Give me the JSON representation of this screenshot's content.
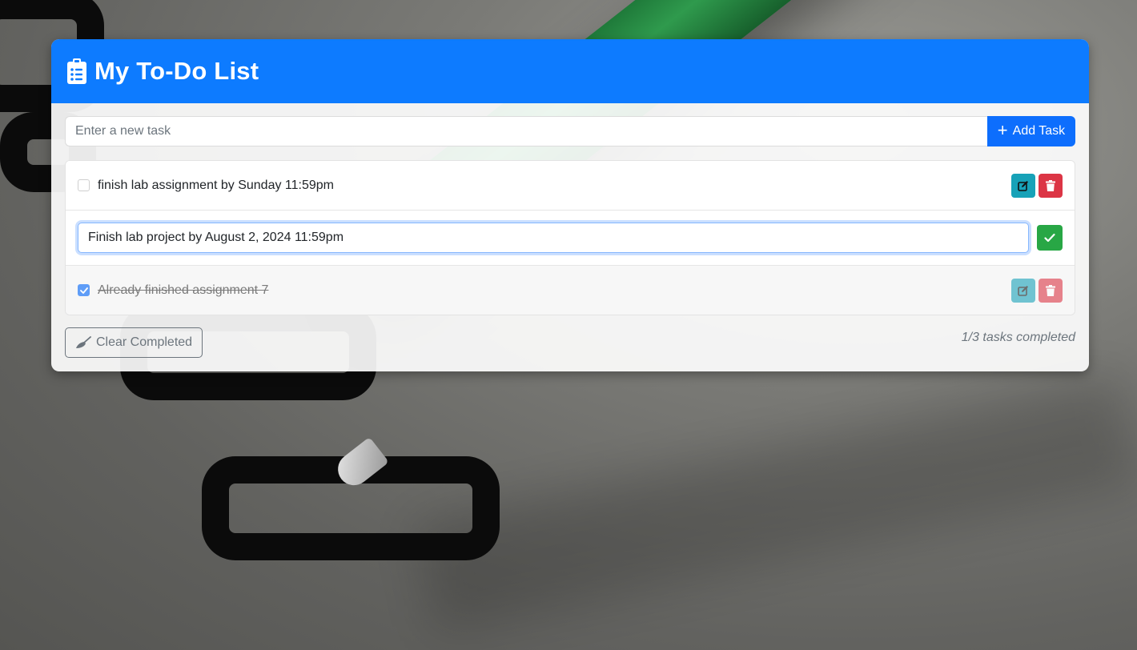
{
  "header": {
    "title": "My To-Do List"
  },
  "new_task": {
    "placeholder": "Enter a new task",
    "value": "",
    "add_label": "Add Task"
  },
  "tasks": [
    {
      "text": "finish lab assignment by Sunday 11:59pm",
      "completed": false,
      "mode": "view"
    },
    {
      "text": "Finish lab project by August 2, 2024 11:59pm",
      "completed": false,
      "mode": "editing"
    },
    {
      "text": "Already finished assignment 7",
      "completed": true,
      "mode": "view"
    }
  ],
  "footer": {
    "clear_label": "Clear Completed",
    "status": "1/3 tasks completed"
  },
  "colors": {
    "primary": "#0d6efd",
    "header": "#0d7bff",
    "info": "#17a2b8",
    "danger": "#dc3545",
    "success": "#28a745"
  },
  "icons": {
    "header": "clipboard-list-icon",
    "add": "plus-icon",
    "edit": "edit-icon",
    "delete": "trash-icon",
    "save": "check-icon",
    "clear": "broom-icon"
  }
}
